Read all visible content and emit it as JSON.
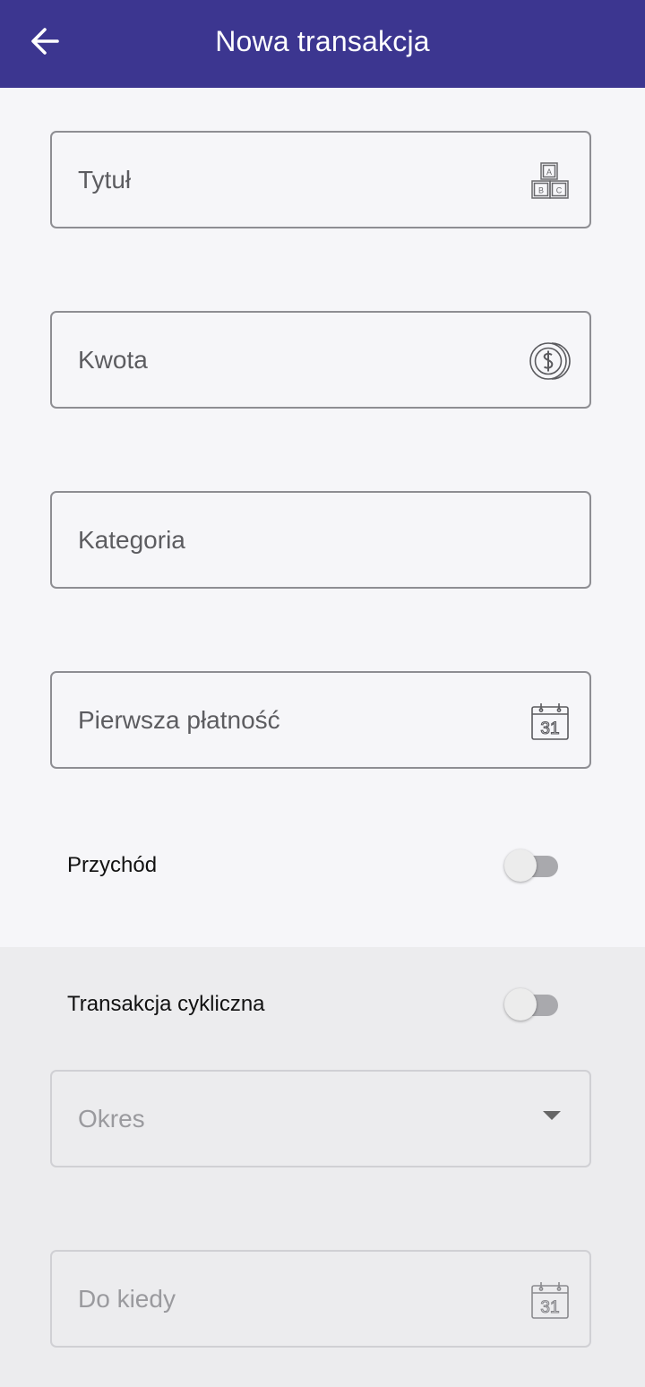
{
  "appbar": {
    "title": "Nowa transakcja",
    "back_icon": "arrow-left-icon",
    "background": "#3c3690"
  },
  "form": {
    "title_field": {
      "label": "Tytuł",
      "icon": "abc-blocks-icon"
    },
    "amount_field": {
      "label": "Kwota",
      "icon": "dollar-coin-icon"
    },
    "category_field": {
      "label": "Kategoria"
    },
    "first_payment_field": {
      "label": "Pierwsza płatność",
      "icon": "calendar-icon",
      "icon_text": "31"
    },
    "income_switch": {
      "label": "Przychód",
      "checked": false
    }
  },
  "cyclic": {
    "switch": {
      "label": "Transakcja cykliczna",
      "checked": false
    },
    "period_select": {
      "label": "Okres",
      "icon": "dropdown-arrow-icon"
    },
    "until_field": {
      "label": "Do kiedy",
      "icon": "calendar-icon",
      "icon_text": "31"
    }
  }
}
